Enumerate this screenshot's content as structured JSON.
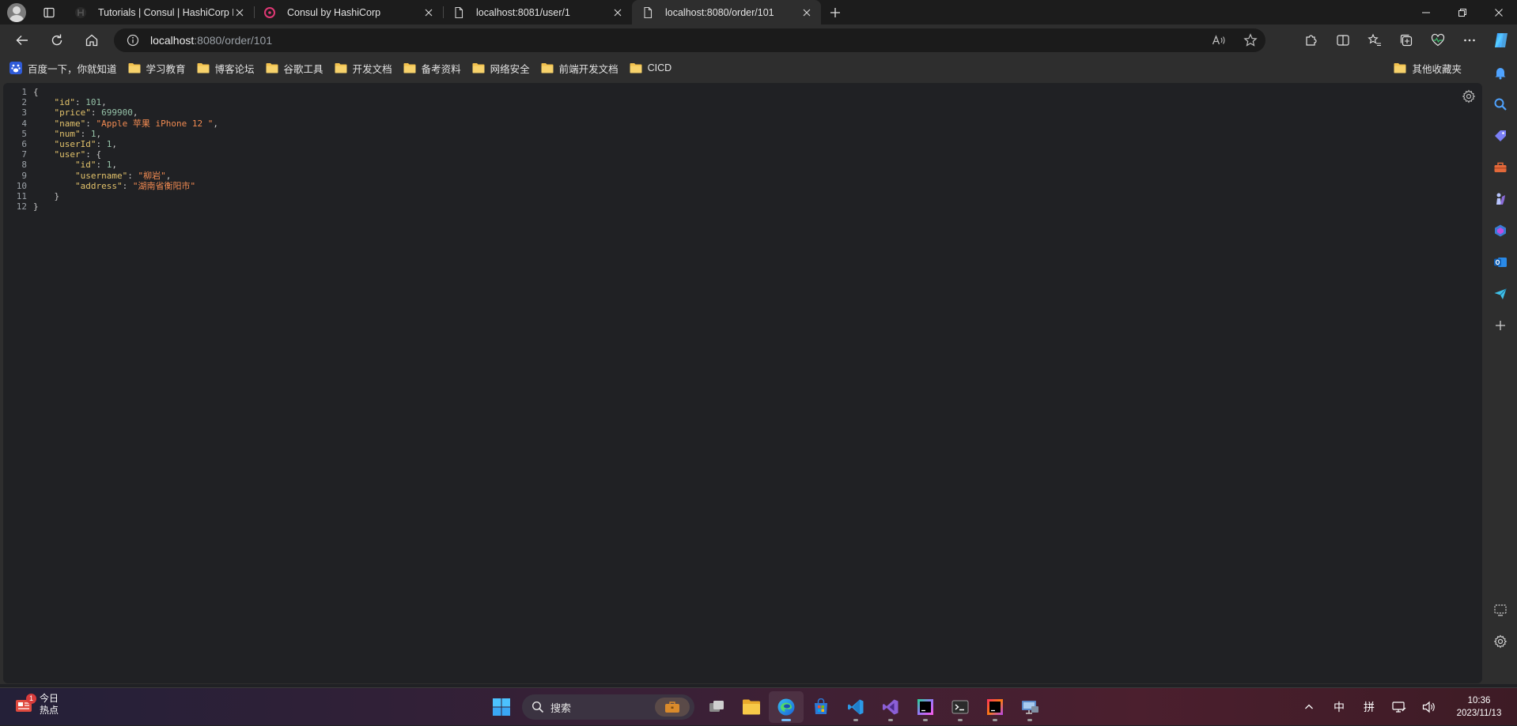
{
  "tabs": [
    {
      "title": "Tutorials | Consul | HashiCorp Developer",
      "favicon": "hashicorp-icon",
      "active": false
    },
    {
      "title": "Consul by HashiCorp",
      "favicon": "consul-icon",
      "active": false
    },
    {
      "title": "localhost:8081/user/1",
      "favicon": "document-icon",
      "active": false
    },
    {
      "title": "localhost:8080/order/101",
      "favicon": "document-icon",
      "active": true
    }
  ],
  "address": {
    "host": "localhost",
    "path": ":8080/order/101"
  },
  "bookmarks": [
    {
      "label": "百度一下，你就知道",
      "icon": "baidu-icon"
    },
    {
      "label": "学习教育",
      "icon": "folder-icon"
    },
    {
      "label": "博客论坛",
      "icon": "folder-icon"
    },
    {
      "label": "谷歌工具",
      "icon": "folder-icon"
    },
    {
      "label": "开发文档",
      "icon": "folder-icon"
    },
    {
      "label": "备考资料",
      "icon": "folder-icon"
    },
    {
      "label": "网络安全",
      "icon": "folder-icon"
    },
    {
      "label": "前端开发文档",
      "icon": "folder-icon"
    },
    {
      "label": "CICD",
      "icon": "folder-icon"
    }
  ],
  "other_bookmarks": "其他收藏夹",
  "json_lines": [
    {
      "n": "1",
      "indent": 0,
      "tokens": [
        {
          "t": "p",
          "v": "{"
        }
      ]
    },
    {
      "n": "2",
      "indent": 1,
      "tokens": [
        {
          "t": "k",
          "v": "\"id\""
        },
        {
          "t": "p",
          "v": ": "
        },
        {
          "t": "n",
          "v": "101"
        },
        {
          "t": "p",
          "v": ","
        }
      ]
    },
    {
      "n": "3",
      "indent": 1,
      "tokens": [
        {
          "t": "k",
          "v": "\"price\""
        },
        {
          "t": "p",
          "v": ": "
        },
        {
          "t": "n",
          "v": "699900"
        },
        {
          "t": "p",
          "v": ","
        }
      ]
    },
    {
      "n": "4",
      "indent": 1,
      "tokens": [
        {
          "t": "k",
          "v": "\"name\""
        },
        {
          "t": "p",
          "v": ": "
        },
        {
          "t": "s",
          "v": "\"Apple 苹果 iPhone 12 \""
        },
        {
          "t": "p",
          "v": ","
        }
      ]
    },
    {
      "n": "5",
      "indent": 1,
      "tokens": [
        {
          "t": "k",
          "v": "\"num\""
        },
        {
          "t": "p",
          "v": ": "
        },
        {
          "t": "n",
          "v": "1"
        },
        {
          "t": "p",
          "v": ","
        }
      ]
    },
    {
      "n": "6",
      "indent": 1,
      "tokens": [
        {
          "t": "k",
          "v": "\"userId\""
        },
        {
          "t": "p",
          "v": ": "
        },
        {
          "t": "n",
          "v": "1"
        },
        {
          "t": "p",
          "v": ","
        }
      ]
    },
    {
      "n": "7",
      "indent": 1,
      "tokens": [
        {
          "t": "k",
          "v": "\"user\""
        },
        {
          "t": "p",
          "v": ": {"
        }
      ]
    },
    {
      "n": "8",
      "indent": 2,
      "tokens": [
        {
          "t": "k",
          "v": "\"id\""
        },
        {
          "t": "p",
          "v": ": "
        },
        {
          "t": "n",
          "v": "1"
        },
        {
          "t": "p",
          "v": ","
        }
      ]
    },
    {
      "n": "9",
      "indent": 2,
      "tokens": [
        {
          "t": "k",
          "v": "\"username\""
        },
        {
          "t": "p",
          "v": ": "
        },
        {
          "t": "s",
          "v": "\"柳岩\""
        },
        {
          "t": "p",
          "v": ","
        }
      ]
    },
    {
      "n": "10",
      "indent": 2,
      "tokens": [
        {
          "t": "k",
          "v": "\"address\""
        },
        {
          "t": "p",
          "v": ": "
        },
        {
          "t": "s",
          "v": "\"湖南省衡阳市\""
        }
      ]
    },
    {
      "n": "11",
      "indent": 1,
      "tokens": [
        {
          "t": "p",
          "v": "}"
        }
      ]
    },
    {
      "n": "12",
      "indent": 0,
      "tokens": [
        {
          "t": "p",
          "v": "}"
        }
      ]
    }
  ],
  "taskbar": {
    "weather_line1": "今日",
    "weather_line2": "热点",
    "weather_badge": "1",
    "search_label": "搜索",
    "apps": [
      "start",
      "search",
      "task-view",
      "file-explorer",
      "edge",
      "microsoft-store",
      "vscode",
      "visual-studio",
      "datagrip",
      "terminal",
      "intellij-idea",
      "remote-desktop"
    ],
    "ime_lang": "中",
    "ime_mode": "拼",
    "time": "10:36",
    "date": "2023/11/13"
  }
}
